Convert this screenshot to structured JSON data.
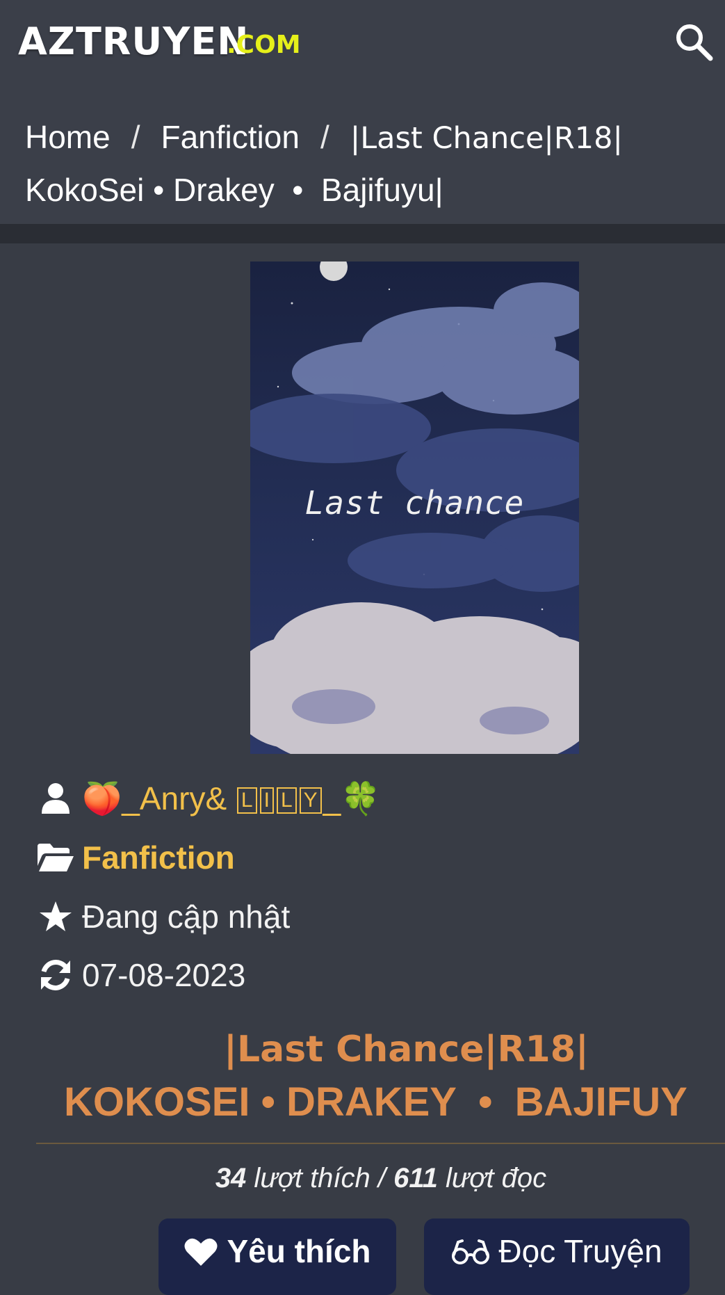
{
  "header": {
    "logo_main": "AZTRUYEN",
    "logo_sub": ".COM",
    "search_icon": "search-icon"
  },
  "breadcrumb": {
    "home": "Home",
    "separator": "/",
    "category": "Fanfiction",
    "current_line1": "|Last Chance|R18|",
    "current_line2": "KokoSei • Drakey  •  Bajifuyu|"
  },
  "cover": {
    "title": "Last chance"
  },
  "meta": {
    "author_prefix": "🍑_Anry& ",
    "author_boxed": [
      "L",
      "I",
      "L",
      "Y"
    ],
    "author_suffix": "_🍀",
    "category": "Fanfiction",
    "status": "Đang cập nhật",
    "updated": "07-08-2023",
    "icons": [
      "user-icon",
      "folder-open-icon",
      "star-icon",
      "refresh-icon"
    ]
  },
  "story": {
    "title_line1": "|Last Chance|R18|",
    "title_line2": "KOKOSEI • DRAKEY  •  BAJIFUY"
  },
  "stats": {
    "likes": "34",
    "likes_label": " lượt thích / ",
    "reads": "611",
    "reads_label": " lượt đọc"
  },
  "actions": {
    "like_label": "Yêu thích",
    "read_label": "Đọc Truyện"
  },
  "colors": {
    "background": "#383c45",
    "accent_gold": "#f2c04a",
    "title_orange": "#df8e4e",
    "button_navy": "#1c2448",
    "logo_yellow": "#e6f01a"
  }
}
